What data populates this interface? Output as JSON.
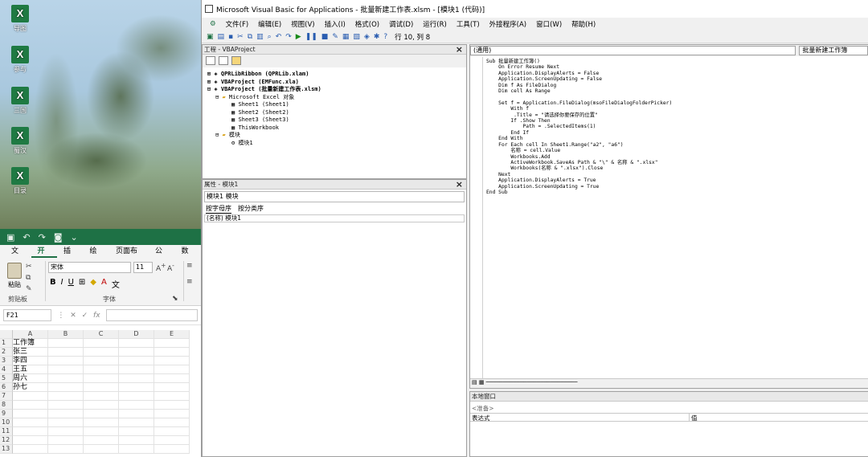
{
  "desktop": {
    "icons": [
      "导图",
      "参与",
      "三国",
      "蜀汉",
      "目录"
    ]
  },
  "excel": {
    "tabs": [
      "文件",
      "开始",
      "插入",
      "绘图",
      "页面布局",
      "公式",
      "数据"
    ],
    "paste_label": "粘贴",
    "clipboard_group": "剪贴板",
    "font_group": "字体",
    "font_name": "宋体",
    "font_size": "11",
    "name_box": "F21",
    "fx": "fx",
    "columns": [
      "A",
      "B",
      "C",
      "D",
      "E"
    ],
    "rows": [
      "1",
      "2",
      "3",
      "4",
      "5",
      "6",
      "7",
      "8",
      "9",
      "10",
      "11",
      "12",
      "13"
    ],
    "cells": [
      "工作簿",
      "张三",
      "李四",
      "王五",
      "周六",
      "孙七"
    ]
  },
  "vba": {
    "title": "Microsoft Visual Basic for Applications - 批量新建工作表.xlsm - [模块1 (代码)]",
    "menu": [
      "文件(F)",
      "编辑(E)",
      "视图(V)",
      "插入(I)",
      "格式(O)",
      "调试(D)",
      "运行(R)",
      "工具(T)",
      "外接程序(A)",
      "窗口(W)",
      "帮助(H)"
    ],
    "cursor_pos": "行 10, 列 8",
    "project": {
      "title": "工程 - VBAProject",
      "tree": [
        "QPRLibRibbon (QPRLib.xlam)",
        "VBAProject (EMFunc.xla)",
        "VBAProject (批量新建工作表.xlsm)",
        "Microsoft Excel 对象",
        "Sheet1 (Sheet1)",
        "Sheet2 (Sheet2)",
        "Sheet3 (Sheet3)",
        "ThisWorkbook",
        "模块",
        "模块1"
      ]
    },
    "properties": {
      "title": "属性 - 模块1",
      "combo": "模块1 模块",
      "tab_alpha": "按字母序",
      "tab_cat": "按分类序",
      "row": "(名称) 模块1"
    },
    "code": {
      "object_combo": "(通用)",
      "proc_combo": "批量新建工作簿",
      "lines": [
        "Sub 批量新建工作簿()",
        "    On Error Resume Next",
        "    Application.DisplayAlerts = False",
        "    Application.ScreenUpdating = False",
        "    Dim f As FileDialog",
        "    Dim cell As Range",
        "",
        "    Set f = Application.FileDialog(msoFileDialogFolderPicker)",
        "        With f",
        "         .Title = \"请选择你要保存的位置\"",
        "        If .Show Then",
        "            Path = .SelectedItems(1)",
        "        End If",
        "    End With",
        "    For Each cell In Sheet1.Range(\"a2\", \"a6\")",
        "        名称 = cell.Value",
        "        Workbooks.Add",
        "        ActiveWorkbook.SaveAs Path & \"\\\" & 名称 & \".xlsx\"",
        "        Workbooks(名称 & \".xlsx\").Close",
        "    Next",
        "    Application.DisplayAlerts = True",
        "    Application.ScreenUpdating = True",
        "End Sub"
      ]
    },
    "locals": {
      "title": "本地窗口",
      "hint": "<准备>",
      "col_expr": "表达式",
      "col_val": "值"
    }
  }
}
